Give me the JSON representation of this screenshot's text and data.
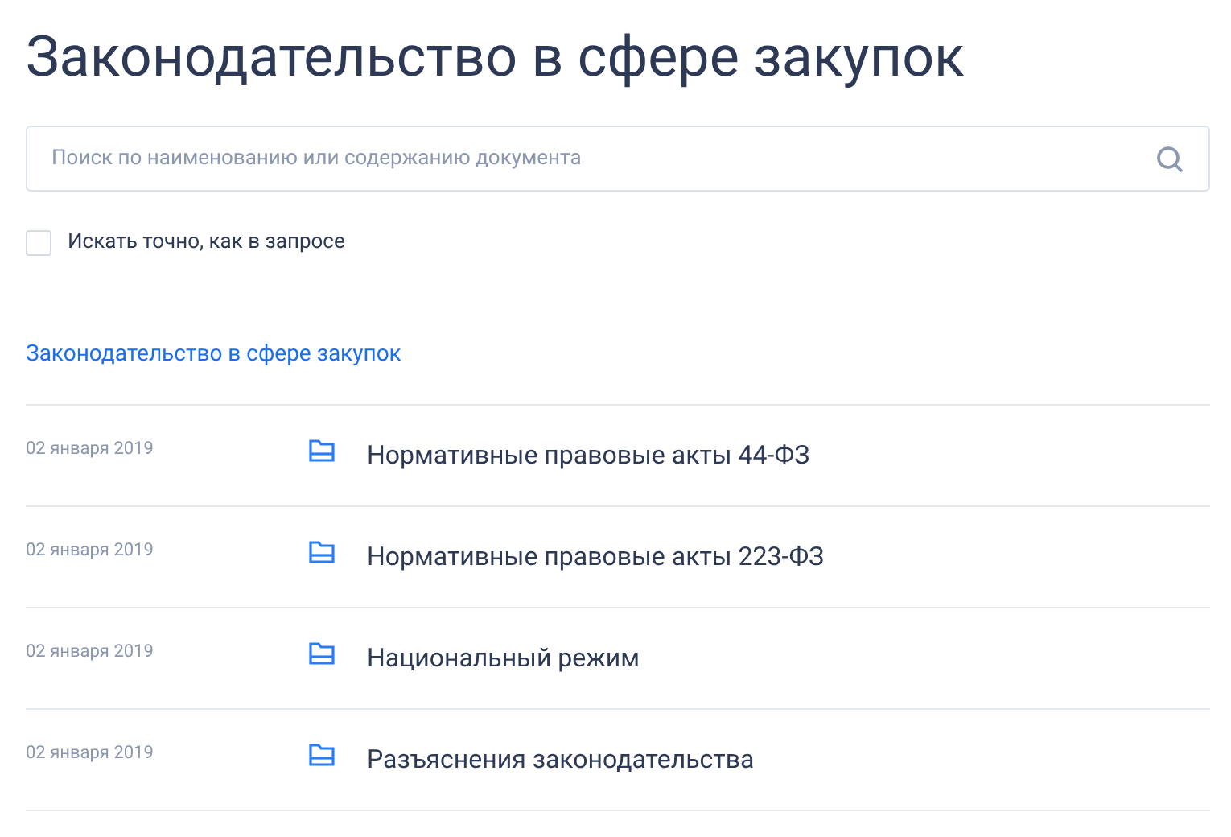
{
  "title": "Законодательство в сфере закупок",
  "search": {
    "placeholder": "Поиск по наименованию или содержанию документа"
  },
  "exact_match": {
    "label": "Искать точно, как в запросе",
    "checked": false
  },
  "breadcrumb": "Законодательство в сфере закупок",
  "items": [
    {
      "date": "02 января 2019",
      "title": "Нормативные правовые акты 44-ФЗ"
    },
    {
      "date": "02 января 2019",
      "title": "Нормативные правовые акты 223-ФЗ"
    },
    {
      "date": "02 января 2019",
      "title": "Национальный режим"
    },
    {
      "date": "02 января 2019",
      "title": "Разъяснения законодательства"
    }
  ]
}
